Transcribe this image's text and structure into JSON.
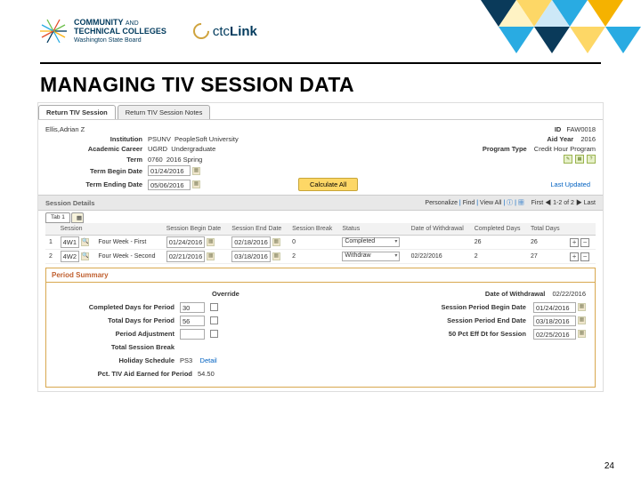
{
  "slide": {
    "title": "MANAGING TIV SESSION DATA",
    "page_number": "24"
  },
  "branding": {
    "community": "COMMUNITY",
    "and": "AND",
    "technical": "TECHNICAL",
    "colleges": "COLLEGES",
    "subtitle": "Washington State Board",
    "ctc_prefix": "ctc",
    "ctc_bold": "Link"
  },
  "tabs": {
    "active": "Return TIV Session",
    "other": "Return TIV Session Notes"
  },
  "student": {
    "name": "Ellis,Adrian Z",
    "id_label": "ID",
    "id_value": "FAW0018"
  },
  "fields": {
    "institution_label": "Institution",
    "institution_code": "PSUNV",
    "institution_name": "PeopleSoft University",
    "aid_year_label": "Aid Year",
    "aid_year": "2016",
    "career_label": "Academic Career",
    "career_code": "UGRD",
    "career_name": "Undergraduate",
    "program_type_label": "Program Type",
    "program_type": "Credit Hour Program",
    "term_label": "Term",
    "term_code": "0760",
    "term_name": "2016 Spring",
    "term_begin_label": "Term Begin Date",
    "term_begin": "01/24/2016",
    "term_end_label": "Term Ending Date",
    "term_end": "05/06/2016",
    "calculate_all": "Calculate All",
    "last_updated_label": "Last Updated"
  },
  "session_header": {
    "title": "Session Details",
    "personalize": "Personalize",
    "find": "Find",
    "viewall": "View All",
    "pager": "First ◀ 1-2 of 2 ▶ Last",
    "grid_tab": "Tab 1"
  },
  "grid_headers": {
    "session": "Session",
    "begin": "Session Begin Date",
    "end": "Session End Date",
    "break": "Session Break",
    "status": "Status",
    "withdrawal": "Date of Withdrawal",
    "completed": "Completed Days",
    "total": "Total Days"
  },
  "sessions": [
    {
      "n": "1",
      "code": "4W1",
      "name": "Four Week - First",
      "begin": "01/24/2016",
      "end": "02/18/2016",
      "break": "0",
      "status": "Completed",
      "withdrawal": "",
      "completed": "26",
      "total": "26"
    },
    {
      "n": "2",
      "code": "4W2",
      "name": "Four Week - Second",
      "begin": "02/21/2016",
      "end": "03/18/2016",
      "break": "2",
      "status": "Withdraw",
      "withdrawal": "02/22/2016",
      "completed": "2",
      "total": "27"
    }
  ],
  "period": {
    "title": "Period Summary",
    "override": "Override",
    "completed_label": "Completed Days for Period",
    "completed_value": "30",
    "total_label": "Total Days for Period",
    "total_value": "56",
    "adjustment_label": "Period Adjustment",
    "session_break_label": "Total Session Break",
    "holiday_label": "Holiday Schedule",
    "holiday_code": "PS3",
    "detail": "Detail",
    "pct_label": "Pct. TIV Aid Earned for Period",
    "pct_value": "54.50",
    "dow_label": "Date of Withdrawal",
    "dow_value": "02/22/2016",
    "spbd_label": "Session Period Begin Date",
    "spbd_value": "01/24/2016",
    "sped_label": "Session Period End Date",
    "sped_value": "03/18/2016",
    "fifty_label": "50 Pct Eff Dt for Session",
    "fifty_value": "02/25/2016"
  }
}
